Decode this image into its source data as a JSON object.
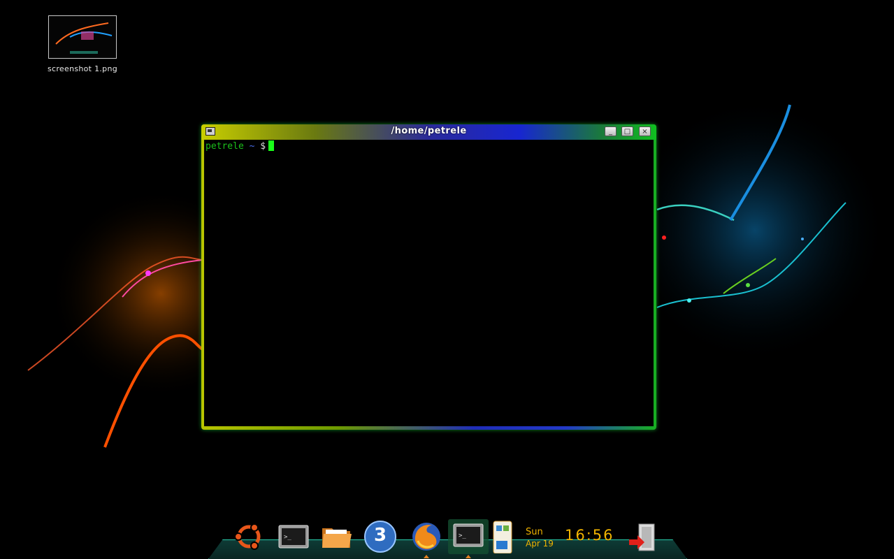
{
  "desktop": {
    "icons": [
      {
        "label": "screenshot 1.png"
      }
    ]
  },
  "window": {
    "title": "/home/petrele",
    "buttons": {
      "minimize": "_",
      "maximize": "□",
      "close": "×"
    },
    "terminal": {
      "user": "petrele",
      "path": "~",
      "symbol": "$"
    }
  },
  "dock": {
    "items": [
      {
        "name": "ubuntu-icon"
      },
      {
        "name": "terminal-icon"
      },
      {
        "name": "folder-icon"
      },
      {
        "name": "workspace-switcher",
        "label": "3"
      },
      {
        "name": "firefox-icon"
      },
      {
        "name": "terminal-active-icon"
      },
      {
        "name": "window-list-icon"
      }
    ],
    "clock": {
      "day": "Sun",
      "date": "Apr 19",
      "time": "16:56"
    }
  },
  "colors": {
    "prompt_user": "#1bbf1b",
    "prompt_path": "#4a6ee8",
    "cursor": "#19ff19",
    "clock": "#f0b300",
    "dock_accent": "#27c9a8"
  }
}
